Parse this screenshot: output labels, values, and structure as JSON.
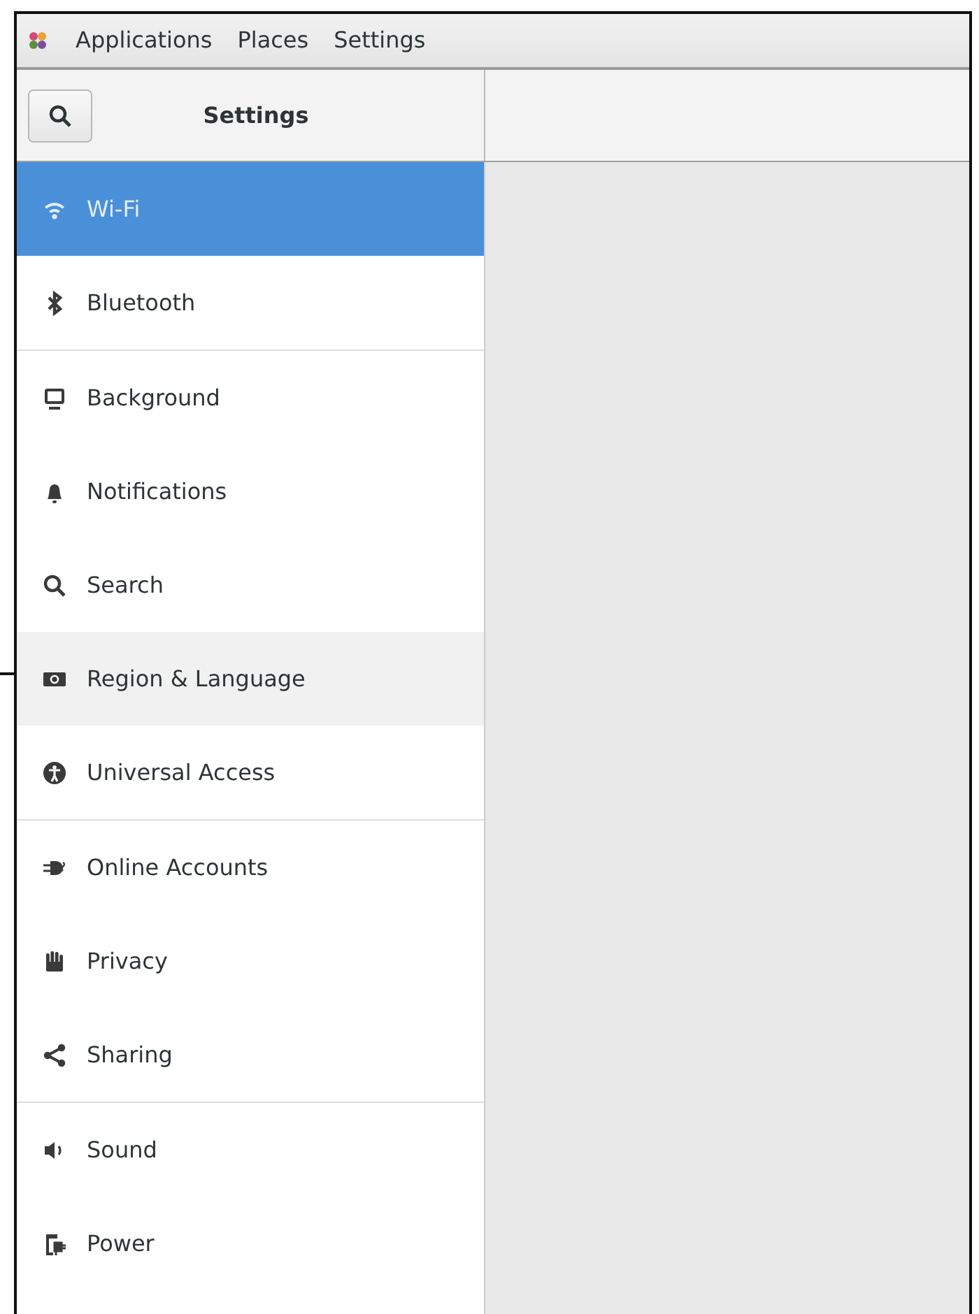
{
  "top_bar": {
    "menus": [
      "Applications",
      "Places",
      "Settings"
    ]
  },
  "header": {
    "title": "Settings"
  },
  "sidebar": {
    "groups": [
      [
        {
          "label": "Wi-Fi",
          "selected": true,
          "hovered": false
        },
        {
          "label": "Bluetooth",
          "selected": false,
          "hovered": false
        }
      ],
      [
        {
          "label": "Background",
          "selected": false,
          "hovered": false
        },
        {
          "label": "Notifications",
          "selected": false,
          "hovered": false
        },
        {
          "label": "Search",
          "selected": false,
          "hovered": false
        },
        {
          "label": "Region & Language",
          "selected": false,
          "hovered": true
        },
        {
          "label": "Universal Access",
          "selected": false,
          "hovered": false
        }
      ],
      [
        {
          "label": "Online Accounts",
          "selected": false,
          "hovered": false
        },
        {
          "label": "Privacy",
          "selected": false,
          "hovered": false
        },
        {
          "label": "Sharing",
          "selected": false,
          "hovered": false
        }
      ],
      [
        {
          "label": "Sound",
          "selected": false,
          "hovered": false
        },
        {
          "label": "Power",
          "selected": false,
          "hovered": false
        }
      ]
    ]
  }
}
